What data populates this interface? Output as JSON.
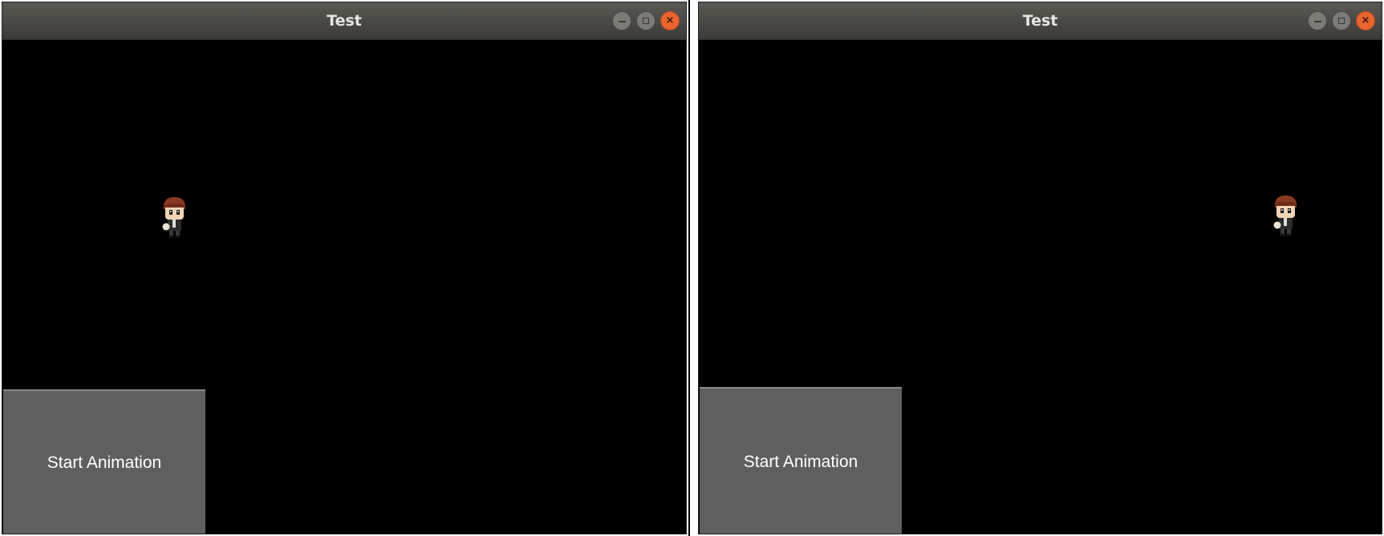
{
  "windows": [
    {
      "title": "Test",
      "button_label": "Start Animation",
      "sprite_icon": "boy-character-sprite-icon"
    },
    {
      "title": "Test",
      "button_label": "Start Animation",
      "sprite_icon": "boy-character-sprite-icon"
    }
  ],
  "colors": {
    "titlebar": "#3c3b37",
    "canvas": "#000000",
    "button": "#5f5f5f",
    "close_button": "#e9642f"
  }
}
